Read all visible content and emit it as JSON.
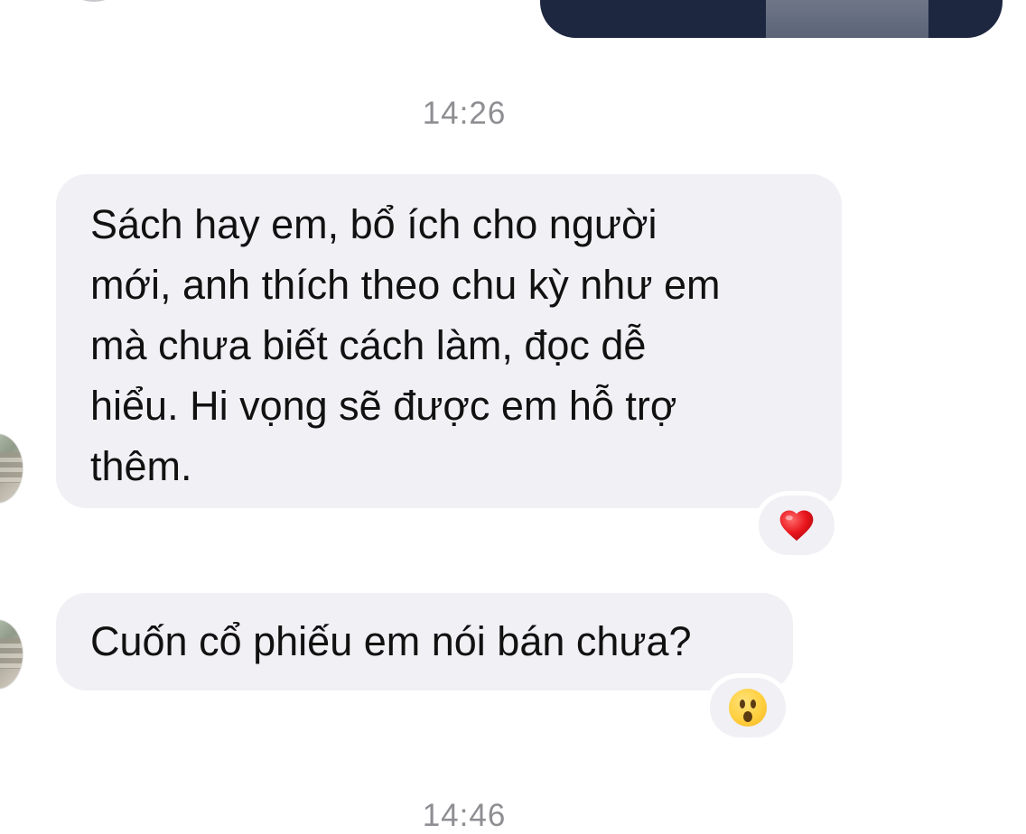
{
  "timestamps": [
    "14:26",
    "14:46"
  ],
  "messages": [
    {
      "lines": [
        "Sách hay em, bổ ích cho người",
        "mới, anh thích theo chu kỳ như em",
        "mà chưa biết cách làm, đọc dễ",
        "hiểu. Hi vọng sẽ được em hỗ trợ",
        "thêm."
      ],
      "reaction": "heart-icon"
    },
    {
      "text": "Cuốn cổ phiếu em nói bán chưa?",
      "reaction": "surprised-face-icon"
    }
  ],
  "colors": {
    "incoming_bubble": "#f0f0f5",
    "timestamp": "#8e8e93",
    "heart": "#e8141b"
  }
}
